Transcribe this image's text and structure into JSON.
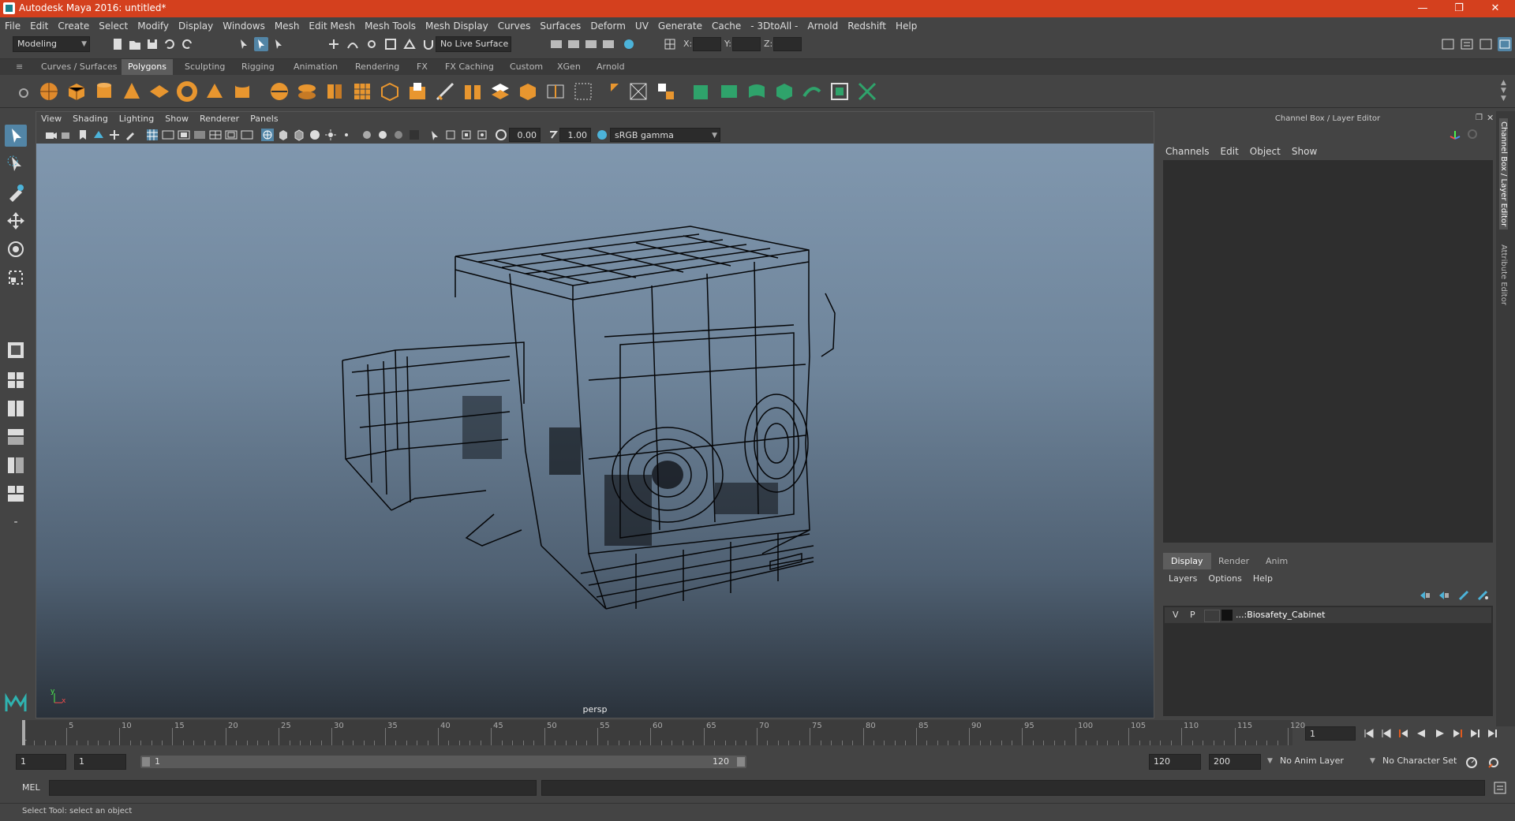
{
  "window": {
    "title": "Autodesk Maya 2016: untitled*",
    "minimize": "—",
    "restore": "❐",
    "close": "✕"
  },
  "menubar": [
    "File",
    "Edit",
    "Create",
    "Select",
    "Modify",
    "Display",
    "Windows",
    "Mesh",
    "Edit Mesh",
    "Mesh Tools",
    "Mesh Display",
    "Curves",
    "Surfaces",
    "Deform",
    "UV",
    "Generate",
    "Cache",
    "- 3DtoAll -",
    "Arnold",
    "Redshift",
    "Help"
  ],
  "statusline": {
    "mode": "Modeling",
    "live_surface": "No Live Surface",
    "x_label": "X:",
    "y_label": "Y:",
    "z_label": "Z:"
  },
  "shelf_tabs": [
    "Curves / Surfaces",
    "Polygons",
    "Sculpting",
    "Rigging",
    "Animation",
    "Rendering",
    "FX",
    "FX Caching",
    "Custom",
    "XGen",
    "Arnold"
  ],
  "shelf_active": "Polygons",
  "viewport": {
    "menu": [
      "View",
      "Shading",
      "Lighting",
      "Show",
      "Renderer",
      "Panels"
    ],
    "exposure": "0.00",
    "gamma": "1.00",
    "color_space": "sRGB gamma",
    "camera_label": "persp",
    "axis_y": "y",
    "axis_x": "x"
  },
  "channel_box": {
    "title": "Channel Box / Layer Editor",
    "menu": [
      "Channels",
      "Edit",
      "Object",
      "Show"
    ]
  },
  "layer_editor": {
    "tabs": [
      "Display",
      "Render",
      "Anim"
    ],
    "active_tab": "Display",
    "menu": [
      "Layers",
      "Options",
      "Help"
    ],
    "layers": [
      {
        "v": "V",
        "p": "P",
        "name": "...:Biosafety_Cabinet"
      }
    ]
  },
  "side_tabs": [
    "Channel Box / Layer Editor",
    "Attribute Editor"
  ],
  "timeslider": {
    "ticks": [
      "5",
      "10",
      "15",
      "20",
      "25",
      "30",
      "35",
      "40",
      "45",
      "50",
      "55",
      "60",
      "65",
      "70",
      "75",
      "80",
      "85",
      "90",
      "95",
      "100",
      "105",
      "110",
      "115",
      "120"
    ],
    "start_label": "1",
    "current_frame": "1"
  },
  "range": {
    "start": "1",
    "playback_start": "1",
    "slider_start": "1",
    "slider_end": "120",
    "playback_end": "120",
    "end": "200",
    "anim_layer": "No Anim Layer",
    "char_set": "No Character Set"
  },
  "cmdline": {
    "label": "MEL"
  },
  "helpline": {
    "text": "Select Tool: select an object"
  }
}
